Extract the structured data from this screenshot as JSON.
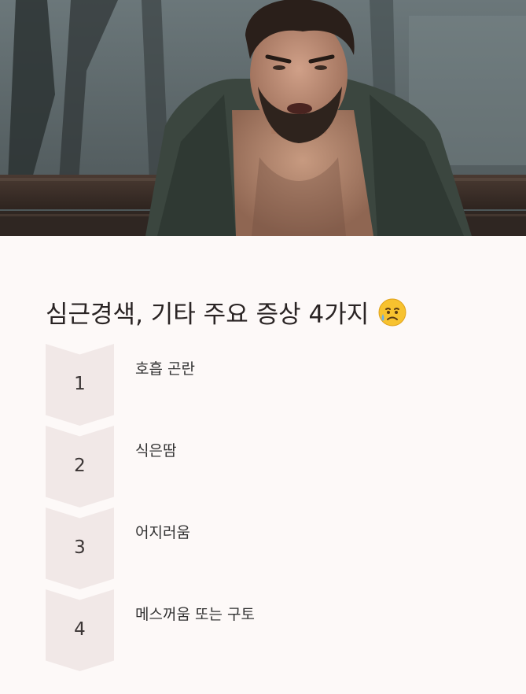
{
  "hero": {
    "image": "man-clutching-chest-on-bench-photo"
  },
  "heading": {
    "title": "심근경색, 기타 주요 증상 4가지",
    "emoji": "sad-sweat-face-icon"
  },
  "steps": [
    {
      "number": "1",
      "label": "호흡 곤란"
    },
    {
      "number": "2",
      "label": "식은땀"
    },
    {
      "number": "3",
      "label": "어지러움"
    },
    {
      "number": "4",
      "label": "메스꺼움 또는 구토"
    }
  ],
  "colors": {
    "background": "#fdf9f8",
    "chevron": "#f1e8e7",
    "text": "#2f2a2a"
  }
}
